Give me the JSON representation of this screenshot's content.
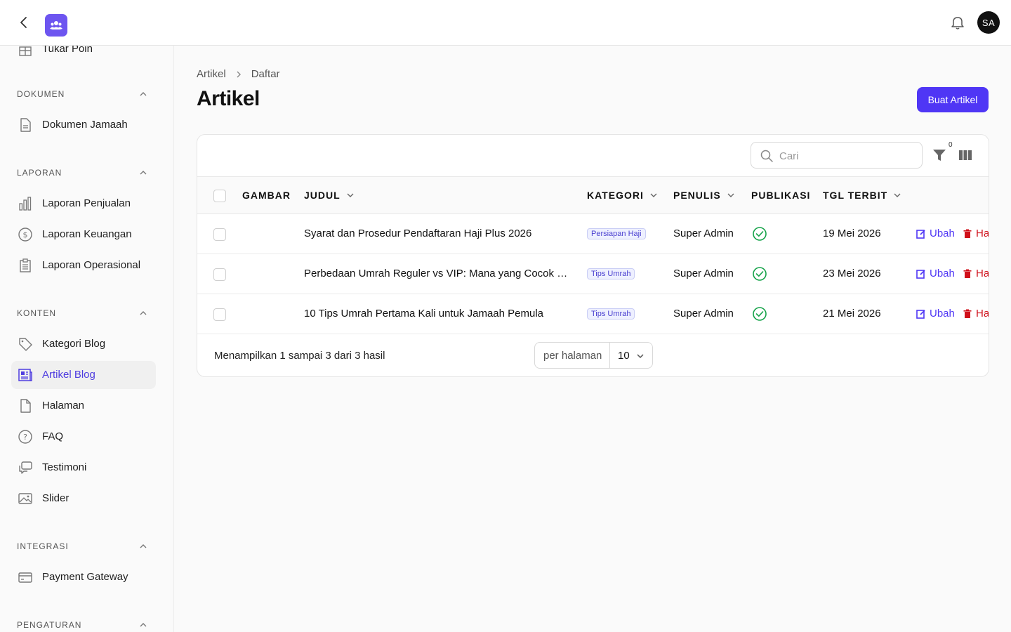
{
  "topbar": {
    "avatar_initials": "SA"
  },
  "sidebar": {
    "partial_item": "Tukar Poin",
    "groups": {
      "dokumen": "DOKUMEN",
      "laporan": "LAPORAN",
      "konten": "KONTEN",
      "integrasi": "INTEGRASI",
      "pengaturan": "PENGATURAN"
    },
    "items": {
      "dokumen_jamaah": "Dokumen Jamaah",
      "laporan_penjualan": "Laporan Penjualan",
      "laporan_keuangan": "Laporan Keuangan",
      "laporan_operasional": "Laporan Operasional",
      "kategori_blog": "Kategori Blog",
      "artikel_blog": "Artikel Blog",
      "halaman": "Halaman",
      "faq": "FAQ",
      "testimoni": "Testimoni",
      "slider": "Slider",
      "payment_gateway": "Payment Gateway"
    },
    "active": "artikel_blog"
  },
  "breadcrumb": {
    "parent": "Artikel",
    "current": "Daftar"
  },
  "page": {
    "title": "Artikel",
    "create_label": "Buat Artikel"
  },
  "table": {
    "search_placeholder": "Cari",
    "filter_count": "0",
    "columns": {
      "gambar": "GAMBAR",
      "judul": "JUDUL",
      "kategori": "KATEGORI",
      "penulis": "PENULIS",
      "publikasi": "PUBLIKASI",
      "tgl_terbit": "TGL TERBIT"
    },
    "rows": [
      {
        "judul": "Syarat dan Prosedur Pendaftaran Haji Plus 2026",
        "kategori": "Persiapan Haji",
        "penulis": "Super Admin",
        "published": true,
        "tgl_terbit": "19 Mei 2026",
        "edit": "Ubah",
        "delete": "Ha"
      },
      {
        "judul": "Perbedaan Umrah Reguler vs VIP: Mana yang Cocok un…",
        "kategori": "Tips Umrah",
        "penulis": "Super Admin",
        "published": true,
        "tgl_terbit": "23 Mei 2026",
        "edit": "Ubah",
        "delete": "Ha"
      },
      {
        "judul": "10 Tips Umrah Pertama Kali untuk Jamaah Pemula",
        "kategori": "Tips Umrah",
        "penulis": "Super Admin",
        "published": true,
        "tgl_terbit": "21 Mei 2026",
        "edit": "Ubah",
        "delete": "Ha"
      }
    ],
    "footer_text": "Menampilkan 1 sampai 3 dari 3 hasil",
    "per_page_label": "per halaman",
    "per_page_value": "10"
  },
  "colors": {
    "accent": "#4f36f5",
    "logo": "#6d55f0",
    "danger": "#d0101a",
    "success": "#16a34a"
  }
}
